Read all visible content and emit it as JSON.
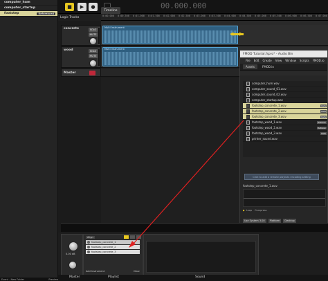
{
  "events": [
    {
      "label": "computer_hum",
      "state": "normal"
    },
    {
      "label": "computer_startup",
      "state": "normal"
    },
    {
      "label": "footstep",
      "state": "selected",
      "badge": "Referenced"
    }
  ],
  "transport": {
    "timecode": "00.000.000",
    "timeline_tab": "Timeline"
  },
  "logic_tracks_label": "Logic Tracks",
  "ruler_ticks": [
    "0:00.000",
    "0:00.500",
    "0:01.000",
    "0:01.500",
    "0:02.000",
    "0:02.500",
    "0:03.000",
    "0:03.500",
    "0:04.000",
    "0:04.500",
    "0:05.000",
    "0:05.500",
    "0:06.000",
    "0:06.500",
    "0:07.000"
  ],
  "tracks": [
    {
      "name": "concrete",
      "solo": "SOLO",
      "mute": "MUTE",
      "clip_label": "Multi Instrument"
    },
    {
      "name": "wood",
      "solo": "SOLO",
      "mute": "MUTE",
      "clip_label": "Multi Instrument"
    }
  ],
  "master_track": {
    "name": "Master"
  },
  "audio_bin": {
    "title": "FMOD Tutorial.fspro* - Audio Bin",
    "menu": [
      "File",
      "Edit",
      "Create",
      "View",
      "Window",
      "Scripts",
      "FMOD.io"
    ],
    "tabs": [
      "Assets",
      "FMOD.io"
    ],
    "files": [
      {
        "name": "computer_hum.wav",
        "highlighted": false,
        "tag": ""
      },
      {
        "name": "computer_sound_01.wav",
        "highlighted": false,
        "tag": ""
      },
      {
        "name": "computer_sound_02.wav",
        "highlighted": false,
        "tag": ""
      },
      {
        "name": "computer_startup.wav",
        "highlighted": false,
        "tag": ""
      },
      {
        "name": "footstep_concrete_1.wav",
        "highlighted": true,
        "tag": "Refe"
      },
      {
        "name": "footstep_concrete_2.wav",
        "highlighted": true,
        "tag": "Refe"
      },
      {
        "name": "footstep_concrete_3.wav",
        "highlighted": true,
        "tag": "Refe"
      },
      {
        "name": "footstep_wood_1.wav",
        "highlighted": false,
        "tag": "Referen"
      },
      {
        "name": "footstep_wood_2.wav",
        "highlighted": false,
        "tag": "Referen"
      },
      {
        "name": "footstep_wood_3.wav",
        "highlighted": false,
        "tag": "Refe"
      },
      {
        "name": "printer_sound.wav",
        "highlighted": false,
        "tag": ""
      }
    ],
    "drop_hint": "Click to add a remote playlists encoding setting",
    "preview_name": "footstep_concrete_1.wav",
    "loop_label": "Loop",
    "compress_label": "Compress",
    "bottom_buttons": [
      "Use System 3.00",
      "Platform",
      "Desktop"
    ]
  },
  "playlist": {
    "header_button": "Align",
    "items": [
      {
        "label": "footstep_concrete_1",
        "selected": true
      },
      {
        "label": "footstep_concrete_2",
        "selected": false
      },
      {
        "label": "footstep_concrete_3",
        "selected": false
      }
    ],
    "add_button": "Add Instrument",
    "clear_button": "Clear"
  },
  "master_panel": {
    "volume_readout": "0.00 dB"
  },
  "deck_labels": {
    "master": "Master",
    "playlist": "Playlist",
    "sound": "Sound"
  },
  "status_bar": {
    "left": "Event - New Folder",
    "right": "Preview"
  },
  "colors": {
    "clip_fill": "#2f5f80",
    "clip_border": "#58a6d6",
    "highlight": "#d9d49a",
    "arrow": "#e02020",
    "loop_region": "#e8c820"
  }
}
